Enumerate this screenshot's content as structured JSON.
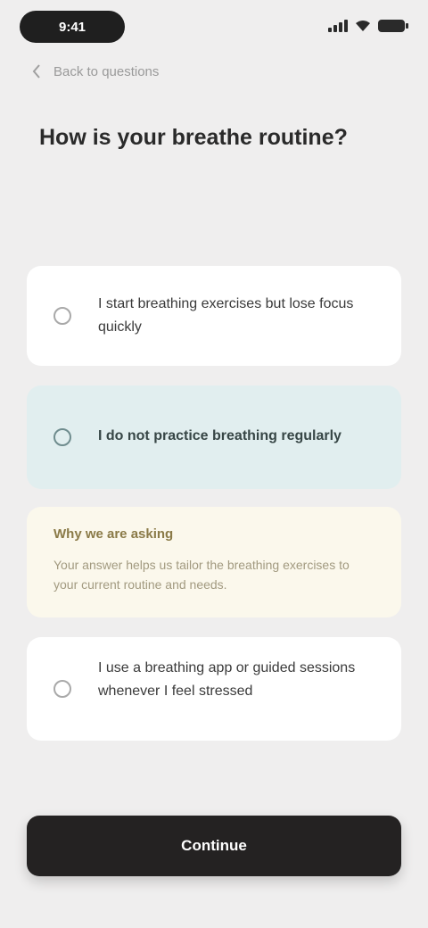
{
  "status_bar": {
    "time": "9:41",
    "icons": [
      "signal-icon",
      "wifi-icon",
      "battery-icon"
    ]
  },
  "nav": {
    "back_label": "Back to questions"
  },
  "question": {
    "title": "How is your breathe routine?"
  },
  "options": [
    {
      "text": "I start breathing exercises but lose focus quickly"
    },
    {
      "text": "I do not practice breathing regularly",
      "selected": true
    },
    {
      "text": "I use a breathing app or guided sessions whenever I feel stressed"
    }
  ],
  "hint": {
    "title": "Why we are asking",
    "body": "Your answer helps us tailor the breathing exercises to your current routine and needs."
  },
  "footer": {
    "continue_label": "Continue"
  },
  "colors": {
    "background": "#efeeee",
    "selected_card": "#e1eeef",
    "hint_card": "#fbf8ec",
    "button": "#242222"
  }
}
